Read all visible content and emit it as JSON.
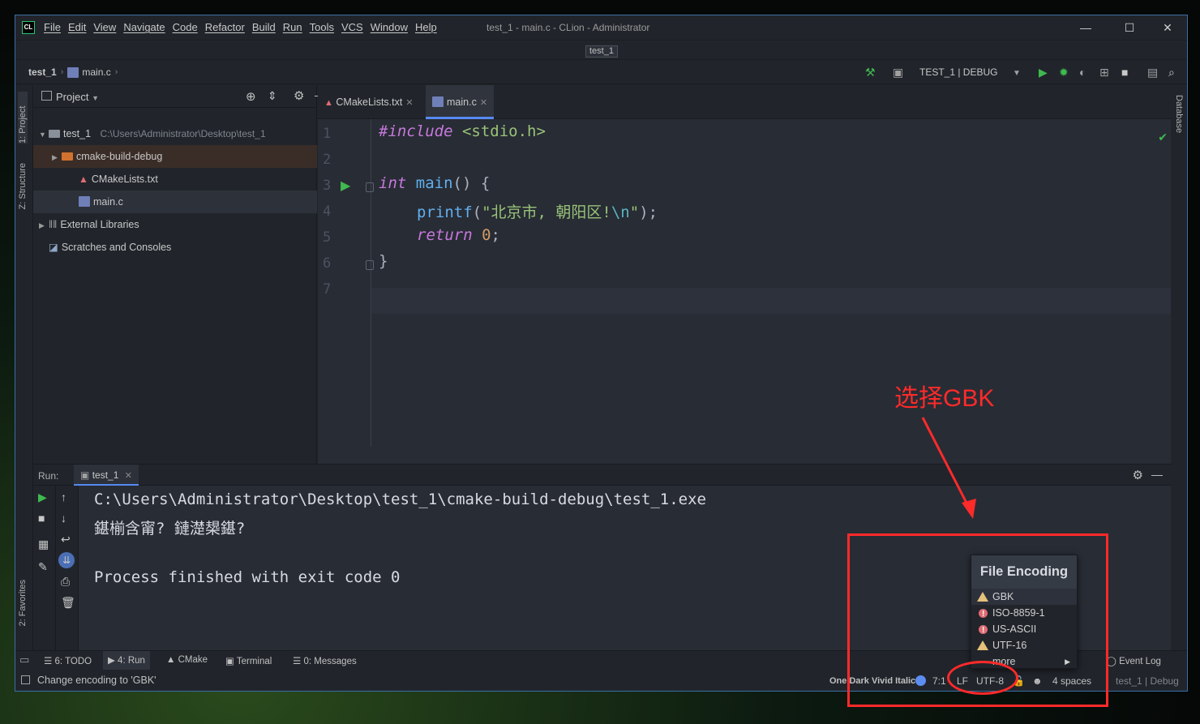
{
  "window": {
    "title": "test_1 - main.c - CLion - Administrator",
    "logo": "CL",
    "minimize": "—",
    "maximize": "☐",
    "close": "✕"
  },
  "menu": [
    "File",
    "Edit",
    "View",
    "Navigate",
    "Code",
    "Refactor",
    "Build",
    "Run",
    "Tools",
    "VCS",
    "Window",
    "Help"
  ],
  "project_tab": "test_1",
  "breadcrumb": {
    "project": "test_1",
    "file": "main.c"
  },
  "toolbar": {
    "run_config": "TEST_1 | DEBUG"
  },
  "left_stripe": {
    "project": "1: Project",
    "structure": "Z: Structure",
    "favorites": "2: Favorites"
  },
  "right_stripe": {
    "database": "Database"
  },
  "project_panel": {
    "title": "Project",
    "tree": [
      {
        "label": "test_1",
        "path": "C:\\Users\\Administrator\\Desktop\\test_1"
      },
      {
        "label": "cmake-build-debug"
      },
      {
        "label": "CMakeLists.txt"
      },
      {
        "label": "main.c"
      },
      {
        "label": "External Libraries"
      },
      {
        "label": "Scratches and Consoles"
      }
    ]
  },
  "editor": {
    "tabs": [
      {
        "label": "CMakeLists.txt",
        "active": false
      },
      {
        "label": "main.c",
        "active": true
      }
    ],
    "line_numbers": [
      "1",
      "2",
      "3",
      "4",
      "5",
      "6",
      "7"
    ],
    "code": {
      "l1_directive": "#include",
      "l1_header": "<stdio.h>",
      "l3_type": "int",
      "l3_name": "main",
      "l3_rest": "() {",
      "l4_fn": "printf",
      "l4_open": "(",
      "l4_str": "\"北京市, 朝阳区!",
      "l4_esc": "\\n",
      "l4_strend": "\"",
      "l4_close": ");",
      "l5_kw": "return",
      "l5_num": "0",
      "l5_end": ";",
      "l6": "}"
    }
  },
  "run_panel": {
    "label": "Run:",
    "tab": "test_1",
    "output": [
      "C:\\Users\\Administrator\\Desktop\\test_1\\cmake-build-debug\\test_1.exe",
      "鍖椾含甯? 鏈濋槼鍖?",
      "",
      "Process finished with exit code 0"
    ]
  },
  "bottom_tabs": {
    "todo": "6: TODO",
    "run": "4: Run",
    "cmake": "CMake",
    "terminal": "Terminal",
    "messages": "0: Messages",
    "event_log": "Event Log"
  },
  "status_bar": {
    "message": "Change encoding to 'GBK'",
    "theme": "One Dark Vivid Italic",
    "position": "7:1",
    "line_sep": "LF",
    "encoding": "UTF-8",
    "indent": "4 spaces",
    "context": "test_1 | Debug"
  },
  "encoding_popup": {
    "title": "File Encoding",
    "items": [
      {
        "label": "GBK",
        "status": "warning"
      },
      {
        "label": "ISO-8859-1",
        "status": "error"
      },
      {
        "label": "US-ASCII",
        "status": "error"
      },
      {
        "label": "UTF-16",
        "status": "warning"
      },
      {
        "label": "more",
        "status": "submenu"
      }
    ]
  },
  "annotation": {
    "text": "选择GBK",
    "color": "#ff2a2a"
  },
  "colors": {
    "accent": "#568af2",
    "run_green": "#3fb950",
    "warning": "#e5c07b",
    "error": "#e06c75"
  }
}
